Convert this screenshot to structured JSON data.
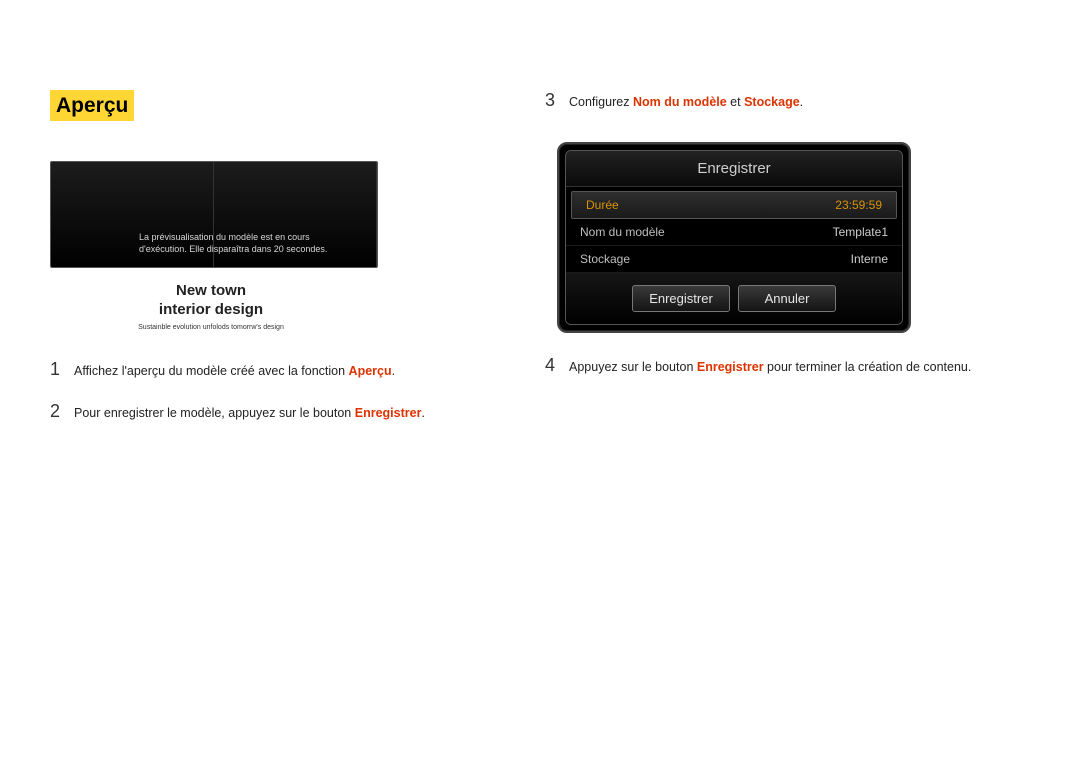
{
  "left": {
    "section_title": "Aperçu",
    "preview": {
      "message": "La prévisualisation du modèle est en cours d'exécution. Elle disparaîtra dans 20 secondes.",
      "caption_line1": "New town",
      "caption_line2": "interior design",
      "caption_sub": "Sustainble evolution unfolods tomorrw's design"
    },
    "steps": [
      {
        "num": "1",
        "pre": "Affichez l'aperçu du modèle créé avec la fonction ",
        "hl": "Aperçu",
        "post": "."
      },
      {
        "num": "2",
        "pre": "Pour enregistrer le modèle, appuyez sur le bouton ",
        "hl": "Enregistrer",
        "post": "."
      }
    ]
  },
  "right": {
    "step3_num": "3",
    "step3_pre": "Configurez ",
    "step3_hl1": "Nom du modèle",
    "step3_mid": " et ",
    "step3_hl2": "Stockage",
    "step3_post": ".",
    "dialog": {
      "title": "Enregistrer",
      "rows": [
        {
          "label": "Durée",
          "value": "23:59:59",
          "selected": true
        },
        {
          "label": "Nom du modèle",
          "value": "Template1",
          "selected": false
        },
        {
          "label": "Stockage",
          "value": "Interne",
          "selected": false
        }
      ],
      "save": "Enregistrer",
      "cancel": "Annuler"
    },
    "step4_num": "4",
    "step4_pre": "Appuyez sur le bouton ",
    "step4_hl": "Enregistrer",
    "step4_post": " pour terminer la création de contenu."
  }
}
